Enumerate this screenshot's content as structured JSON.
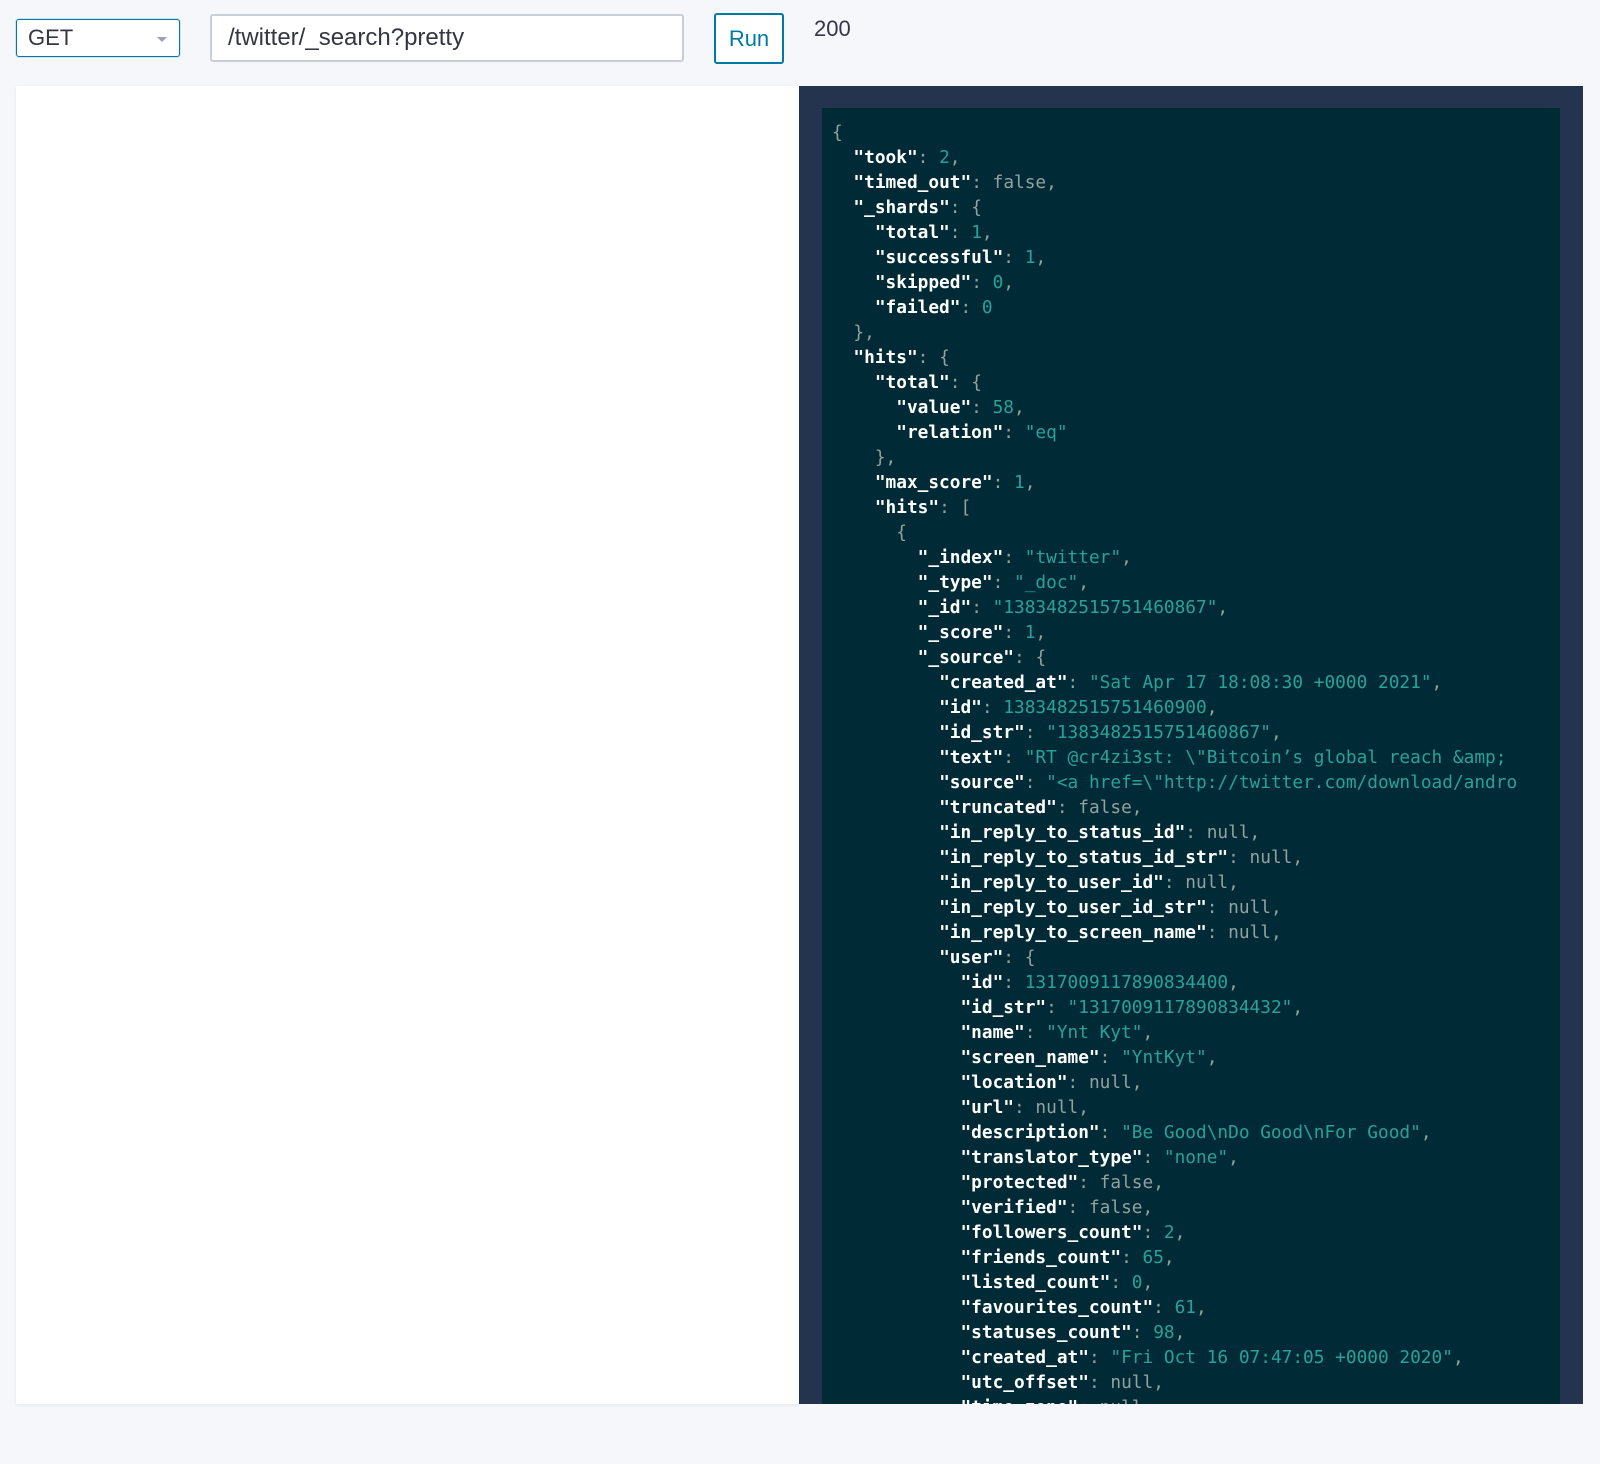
{
  "toolbar": {
    "method": "GET",
    "url": "/twitter/_search?pretty",
    "run_label": "Run",
    "status": "200"
  },
  "response_lines": [
    [
      0,
      "{",
      [],
      ""
    ],
    [
      1,
      "",
      [
        "k",
        "took"
      ],
      [
        "n",
        "2"
      ],
      ","
    ],
    [
      1,
      "",
      [
        "k",
        "timed_out"
      ],
      [
        "b",
        "false"
      ],
      ","
    ],
    [
      1,
      "",
      [
        "k",
        "_shards"
      ],
      [
        "p",
        "{"
      ],
      ""
    ],
    [
      2,
      "",
      [
        "k",
        "total"
      ],
      [
        "n",
        "1"
      ],
      ","
    ],
    [
      2,
      "",
      [
        "k",
        "successful"
      ],
      [
        "n",
        "1"
      ],
      ","
    ],
    [
      2,
      "",
      [
        "k",
        "skipped"
      ],
      [
        "n",
        "0"
      ],
      ","
    ],
    [
      2,
      "",
      [
        "k",
        "failed"
      ],
      [
        "n",
        "0"
      ],
      ""
    ],
    [
      1,
      "},",
      [],
      ""
    ],
    [
      1,
      "",
      [
        "k",
        "hits"
      ],
      [
        "p",
        "{"
      ],
      ""
    ],
    [
      2,
      "",
      [
        "k",
        "total"
      ],
      [
        "p",
        "{"
      ],
      ""
    ],
    [
      3,
      "",
      [
        "k",
        "value"
      ],
      [
        "n",
        "58"
      ],
      ","
    ],
    [
      3,
      "",
      [
        "k",
        "relation"
      ],
      [
        "s",
        "\"eq\""
      ],
      ""
    ],
    [
      2,
      "},",
      [],
      ""
    ],
    [
      2,
      "",
      [
        "k",
        "max_score"
      ],
      [
        "n",
        "1"
      ],
      ","
    ],
    [
      2,
      "",
      [
        "k",
        "hits"
      ],
      [
        "p",
        "["
      ],
      ""
    ],
    [
      3,
      "{",
      [],
      ""
    ],
    [
      4,
      "",
      [
        "k",
        "_index"
      ],
      [
        "s",
        "\"twitter\""
      ],
      ","
    ],
    [
      4,
      "",
      [
        "k",
        "_type"
      ],
      [
        "s",
        "\"_doc\""
      ],
      ","
    ],
    [
      4,
      "",
      [
        "k",
        "_id"
      ],
      [
        "s",
        "\"1383482515751460867\""
      ],
      ","
    ],
    [
      4,
      "",
      [
        "k",
        "_score"
      ],
      [
        "n",
        "1"
      ],
      ","
    ],
    [
      4,
      "",
      [
        "k",
        "_source"
      ],
      [
        "p",
        "{"
      ],
      ""
    ],
    [
      5,
      "",
      [
        "k",
        "created_at"
      ],
      [
        "s",
        "\"Sat Apr 17 18:08:30 +0000 2021\""
      ],
      ","
    ],
    [
      5,
      "",
      [
        "k",
        "id"
      ],
      [
        "n",
        "1383482515751460900"
      ],
      ","
    ],
    [
      5,
      "",
      [
        "k",
        "id_str"
      ],
      [
        "s",
        "\"1383482515751460867\""
      ],
      ","
    ],
    [
      5,
      "",
      [
        "k",
        "text"
      ],
      [
        "s",
        "\"RT @cr4zi3st: \\\"Bitcoin’s global reach &amp;"
      ],
      ""
    ],
    [
      5,
      "",
      [
        "k",
        "source"
      ],
      [
        "s",
        "\"<a href=\\\"http://twitter.com/download/andro"
      ],
      ""
    ],
    [
      5,
      "",
      [
        "k",
        "truncated"
      ],
      [
        "b",
        "false"
      ],
      ","
    ],
    [
      5,
      "",
      [
        "k",
        "in_reply_to_status_id"
      ],
      [
        "b",
        "null"
      ],
      ","
    ],
    [
      5,
      "",
      [
        "k",
        "in_reply_to_status_id_str"
      ],
      [
        "b",
        "null"
      ],
      ","
    ],
    [
      5,
      "",
      [
        "k",
        "in_reply_to_user_id"
      ],
      [
        "b",
        "null"
      ],
      ","
    ],
    [
      5,
      "",
      [
        "k",
        "in_reply_to_user_id_str"
      ],
      [
        "b",
        "null"
      ],
      ","
    ],
    [
      5,
      "",
      [
        "k",
        "in_reply_to_screen_name"
      ],
      [
        "b",
        "null"
      ],
      ","
    ],
    [
      5,
      "",
      [
        "k",
        "user"
      ],
      [
        "p",
        "{"
      ],
      ""
    ],
    [
      6,
      "",
      [
        "k",
        "id"
      ],
      [
        "n",
        "1317009117890834400"
      ],
      ","
    ],
    [
      6,
      "",
      [
        "k",
        "id_str"
      ],
      [
        "s",
        "\"1317009117890834432\""
      ],
      ","
    ],
    [
      6,
      "",
      [
        "k",
        "name"
      ],
      [
        "s",
        "\"Ynt Kyt\""
      ],
      ","
    ],
    [
      6,
      "",
      [
        "k",
        "screen_name"
      ],
      [
        "s",
        "\"YntKyt\""
      ],
      ","
    ],
    [
      6,
      "",
      [
        "k",
        "location"
      ],
      [
        "b",
        "null"
      ],
      ","
    ],
    [
      6,
      "",
      [
        "k",
        "url"
      ],
      [
        "b",
        "null"
      ],
      ","
    ],
    [
      6,
      "",
      [
        "k",
        "description"
      ],
      [
        "s",
        "\"Be Good\\nDo Good\\nFor Good\""
      ],
      ","
    ],
    [
      6,
      "",
      [
        "k",
        "translator_type"
      ],
      [
        "s",
        "\"none\""
      ],
      ","
    ],
    [
      6,
      "",
      [
        "k",
        "protected"
      ],
      [
        "b",
        "false"
      ],
      ","
    ],
    [
      6,
      "",
      [
        "k",
        "verified"
      ],
      [
        "b",
        "false"
      ],
      ","
    ],
    [
      6,
      "",
      [
        "k",
        "followers_count"
      ],
      [
        "n",
        "2"
      ],
      ","
    ],
    [
      6,
      "",
      [
        "k",
        "friends_count"
      ],
      [
        "n",
        "65"
      ],
      ","
    ],
    [
      6,
      "",
      [
        "k",
        "listed_count"
      ],
      [
        "n",
        "0"
      ],
      ","
    ],
    [
      6,
      "",
      [
        "k",
        "favourites_count"
      ],
      [
        "n",
        "61"
      ],
      ","
    ],
    [
      6,
      "",
      [
        "k",
        "statuses_count"
      ],
      [
        "n",
        "98"
      ],
      ","
    ],
    [
      6,
      "",
      [
        "k",
        "created_at"
      ],
      [
        "s",
        "\"Fri Oct 16 07:47:05 +0000 2020\""
      ],
      ","
    ],
    [
      6,
      "",
      [
        "k",
        "utc_offset"
      ],
      [
        "b",
        "null"
      ],
      ","
    ],
    [
      6,
      "",
      [
        "k",
        "time_zone"
      ],
      [
        "b",
        "null"
      ],
      ","
    ]
  ]
}
